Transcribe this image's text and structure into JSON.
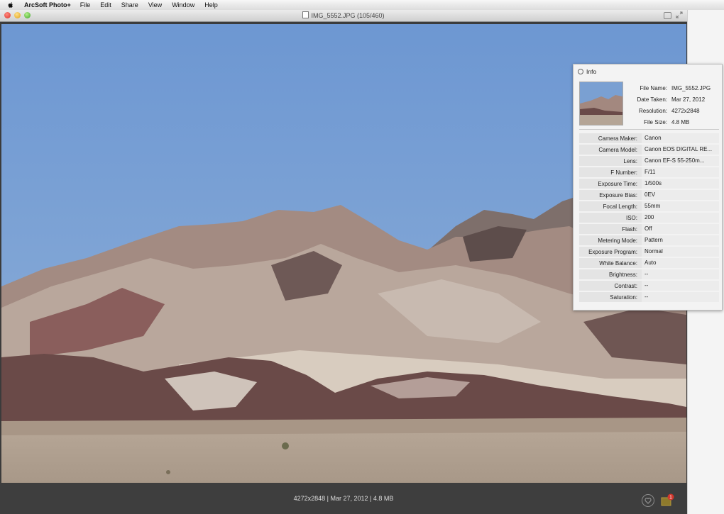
{
  "menubar": {
    "app_name": "ArcSoft Photo+",
    "items": [
      "File",
      "Edit",
      "Share",
      "View",
      "Window",
      "Help"
    ]
  },
  "window": {
    "title": "IMG_5552.JPG (105/460)"
  },
  "statusbar": {
    "text": "4272x2848 | Mar 27, 2012 | 4.8 MB",
    "tray_badge": "1"
  },
  "info_panel": {
    "title": "Info",
    "file": [
      {
        "key": "File Name:",
        "value": "IMG_5552.JPG"
      },
      {
        "key": "Date Taken:",
        "value": "Mar 27, 2012"
      },
      {
        "key": "Resolution:",
        "value": "4272x2848"
      },
      {
        "key": "File Size:",
        "value": "4.8 MB"
      }
    ],
    "exif": [
      {
        "key": "Camera Maker:",
        "value": "Canon"
      },
      {
        "key": "Camera Model:",
        "value": "Canon EOS DIGITAL RE..."
      },
      {
        "key": "Lens:",
        "value": "Canon EF-S 55-250m..."
      },
      {
        "key": "F Number:",
        "value": "F/11"
      },
      {
        "key": "Exposure Time:",
        "value": "1/500s"
      },
      {
        "key": "Exposure Bias:",
        "value": "0EV"
      },
      {
        "key": "Focal Length:",
        "value": "55mm"
      },
      {
        "key": "ISO:",
        "value": "200"
      },
      {
        "key": "Flash:",
        "value": "Off"
      },
      {
        "key": "Metering Mode:",
        "value": "Pattern"
      },
      {
        "key": "Exposure Program:",
        "value": "Normal"
      },
      {
        "key": "White Balance:",
        "value": "Auto"
      },
      {
        "key": "Brightness:",
        "value": "--"
      },
      {
        "key": "Contrast:",
        "value": "--"
      },
      {
        "key": "Saturation:",
        "value": "--"
      }
    ]
  },
  "colors": {
    "sky": "#7ea3d6",
    "statusbar": "#3e3e3e",
    "panel": "#f3f3f3"
  }
}
